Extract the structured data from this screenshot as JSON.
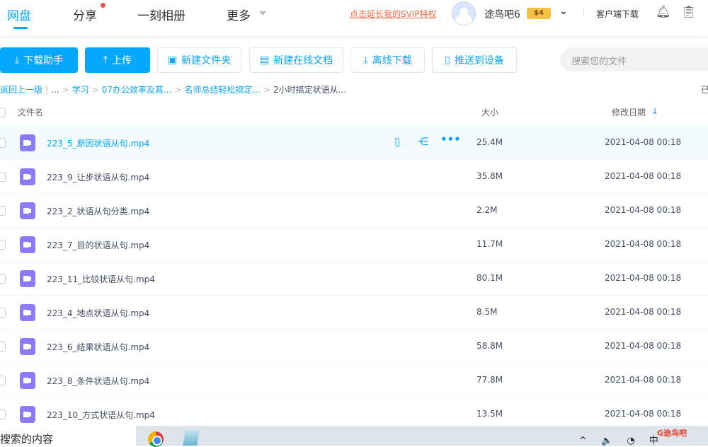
{
  "nav": {
    "tabs": [
      "网盘",
      "分享",
      "一刻相册",
      "更多"
    ],
    "svip_link": "点击延长我的SVIP特权",
    "username": "途鸟吧6",
    "vip_badge": "$4",
    "client_download": "客户端下载"
  },
  "toolbar": {
    "download_helper": "下载助手",
    "upload": "上传",
    "new_folder": "新建文件夹",
    "new_doc": "新建在线文档",
    "offline_download": "离线下载",
    "push_device": "推送到设备",
    "search_placeholder": "搜索您的文件"
  },
  "breadcrumb": {
    "back": "返回上一级",
    "ellipsis": "...",
    "items": [
      "学习",
      "07办公效率及其...",
      "名师总结轻松搞定..."
    ],
    "current": "2小时搞定状语从...",
    "right_cut": "已"
  },
  "table": {
    "headers": {
      "name": "文件名",
      "size": "大小",
      "date": "修改日期"
    },
    "rows": [
      {
        "name": "223_5_原因状语从句.mp4",
        "size": "25.4M",
        "date": "2021-04-08 00:18"
      },
      {
        "name": "223_9_让步状语从句.mp4",
        "size": "35.8M",
        "date": "2021-04-08 00:18"
      },
      {
        "name": "223_2_状语从句分类.mp4",
        "size": "2.2M",
        "date": "2021-04-08 00:18"
      },
      {
        "name": "223_7_目的状语从句.mp4",
        "size": "11.7M",
        "date": "2021-04-08 00:18"
      },
      {
        "name": "223_11_比较状语从句.mp4",
        "size": "80.1M",
        "date": "2021-04-08 00:18"
      },
      {
        "name": "223_4_地点状语从句.mp4",
        "size": "8.5M",
        "date": "2021-04-08 00:18"
      },
      {
        "name": "223_6_结果状语从句.mp4",
        "size": "58.8M",
        "date": "2021-04-08 00:18"
      },
      {
        "name": "223_8_条件状语从句.mp4",
        "size": "77.8M",
        "date": "2021-04-08 00:18"
      },
      {
        "name": "223_10_方式状语从句.mp4",
        "size": "13.5M",
        "date": "2021-04-08 00:18"
      }
    ]
  },
  "taskbar": {
    "search_text": "搜索的内容",
    "tray": "^ 🔈 ◔ 中",
    "watermark": "途鸟吧"
  },
  "colors": {
    "accent": "#06a7ff",
    "video_icon": "#8c7af7",
    "svip": "#f06a4b"
  }
}
